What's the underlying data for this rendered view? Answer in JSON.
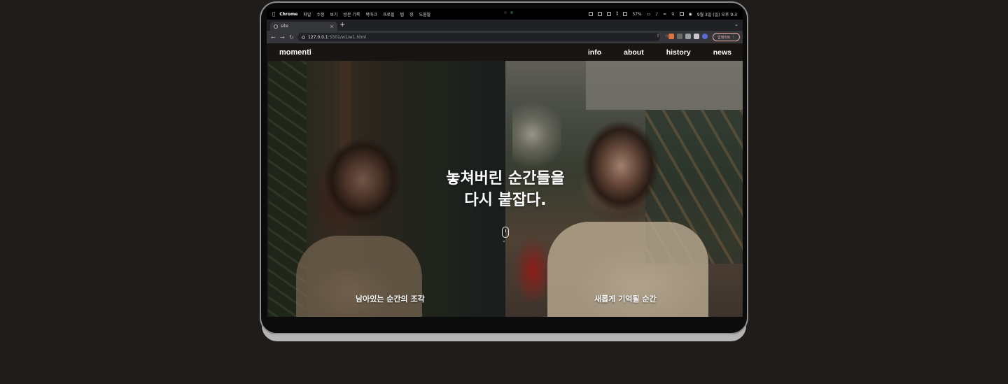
{
  "menubar": {
    "app": "Chrome",
    "items": [
      "파일",
      "수정",
      "보기",
      "방문 기록",
      "북마크",
      "프로필",
      "탭",
      "창",
      "도움말"
    ],
    "battery": "37%",
    "datetime": "9월 3일 (일) 오후 9:3"
  },
  "browser": {
    "tab_title": "site",
    "new_tab": "+",
    "url_host": "127.0.0.1",
    "url_path": ":5501/w1/w1.html",
    "update_label": "업데이트"
  },
  "site": {
    "brand": "momenti",
    "nav": [
      "info",
      "about",
      "history",
      "news"
    ],
    "headline_line1": "놓쳐버린 순간들을",
    "headline_line2": "다시 붙잡다.",
    "caption_left": "남아있는 순간의 조각",
    "caption_right": "새롭게 기억될 순간"
  },
  "colors": {
    "page_bg": "#1f1b18",
    "site_header_bg": "#181512",
    "text": "#ffffff"
  }
}
